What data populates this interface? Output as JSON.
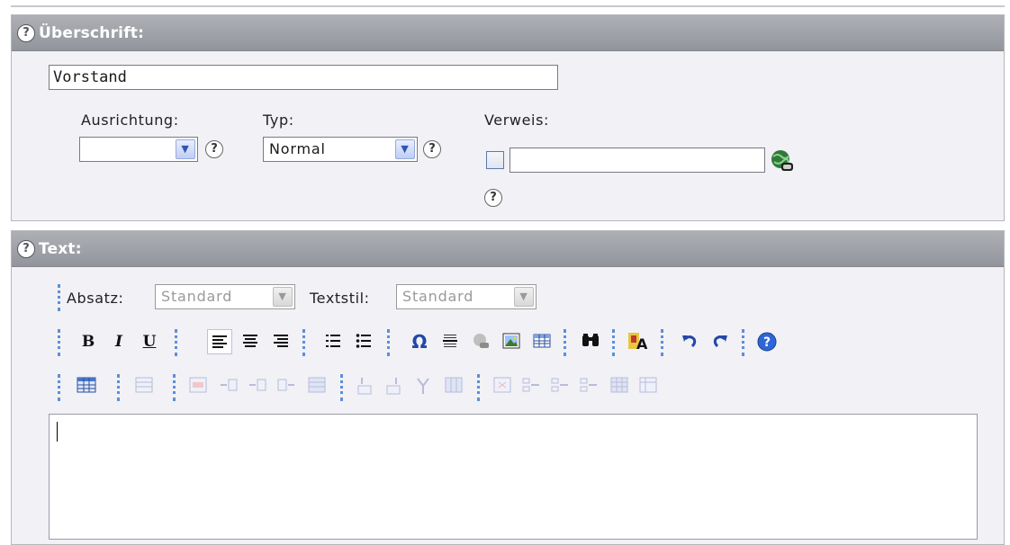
{
  "heading_section": {
    "title": "Überschrift:",
    "help_icon": "?",
    "heading_value": "Vorstand",
    "alignment": {
      "label": "Ausrichtung:",
      "selected": ""
    },
    "type": {
      "label": "Typ:",
      "selected": "Normal"
    },
    "link": {
      "label": "Verweis:",
      "value": "",
      "checked": false
    }
  },
  "text_section": {
    "title": "Text:",
    "help_icon": "?",
    "paragraph": {
      "label": "Absatz:",
      "selected": "Standard"
    },
    "text_style": {
      "label": "Textstil:",
      "selected": "Standard"
    },
    "toolbar": {
      "bold": "B",
      "italic": "I",
      "underline": "U",
      "special_char": "Ω"
    },
    "editor_content": ""
  }
}
